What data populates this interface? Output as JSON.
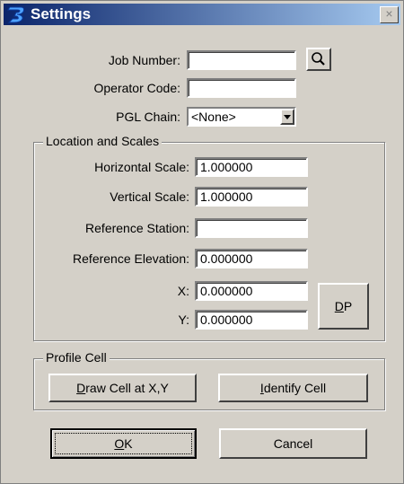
{
  "window": {
    "title": "Settings",
    "close_glyph": "×"
  },
  "job": {
    "label": "Job Number:",
    "value": ""
  },
  "operator": {
    "label": "Operator Code:",
    "value": ""
  },
  "pgl": {
    "label": "PGL Chain:",
    "selected": "<None>"
  },
  "location_group": {
    "legend": "Location and Scales",
    "horizontal": {
      "label": "Horizontal Scale:",
      "value": "1.000000"
    },
    "vertical": {
      "label": "Vertical Scale:",
      "value": "1.000000"
    },
    "ref_station": {
      "label": "Reference Station:",
      "value": ""
    },
    "ref_elevation": {
      "label": "Reference Elevation:",
      "value": "0.000000"
    },
    "x": {
      "label": "X:",
      "value": "0.000000"
    },
    "y": {
      "label": "Y:",
      "value": "0.000000"
    },
    "dp_button": {
      "mnemonic": "D",
      "rest": "P"
    }
  },
  "profile_group": {
    "legend": "Profile Cell",
    "draw_button": {
      "mnemonic": "D",
      "rest": "raw Cell at X,Y"
    },
    "identify_button": {
      "mnemonic": "I",
      "rest": "dentify Cell"
    }
  },
  "footer": {
    "ok": {
      "mnemonic": "O",
      "rest": "K"
    },
    "cancel": "Cancel"
  },
  "icons": {
    "app": "geopak-icon",
    "search": "magnifier-icon",
    "dropdown": "down-arrow-icon"
  }
}
